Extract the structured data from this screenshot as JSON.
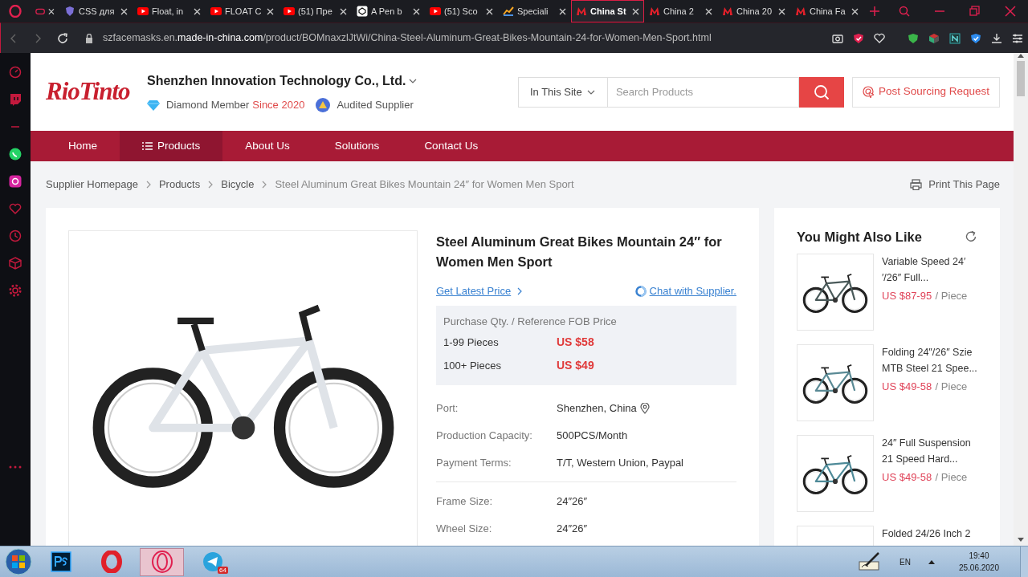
{
  "browser": {
    "tabs": [
      {
        "selected": false
      },
      {
        "title": "CSS для",
        "selected": false
      },
      {
        "title": "Float, in",
        "selected": false
      },
      {
        "title": "FLOAT C",
        "selected": false
      },
      {
        "title": "(51) Пре",
        "selected": false
      },
      {
        "title": "A Pen b",
        "selected": false
      },
      {
        "title": "(51) Sco",
        "selected": false
      },
      {
        "title": "Speciali",
        "selected": false
      },
      {
        "title": "China St",
        "selected": true
      },
      {
        "title": "China 2",
        "selected": false
      },
      {
        "title": "China 20",
        "selected": false
      },
      {
        "title": "China Fa",
        "selected": false
      }
    ],
    "url": "szfacemasks.en.**made-in-china.com**/product/BOMnaxzlJtWi/China-Steel-Aluminum-Great-Bikes-Mountain-24-for-Women-Men-Sport.html"
  },
  "header": {
    "logo": "RioTinto",
    "company": "Shenzhen Innovation Technology Co., Ltd.",
    "member": "Diamond Member",
    "since": "Since 2020",
    "audited": "Audited Supplier",
    "search_scope": "In This Site",
    "search_placeholder": "Search Products",
    "post_request": "Post Sourcing Request"
  },
  "nav": [
    {
      "label": "Home",
      "selected": false
    },
    {
      "label": "Products",
      "selected": true
    },
    {
      "label": "About Us",
      "selected": false
    },
    {
      "label": "Solutions",
      "selected": false
    },
    {
      "label": "Contact Us",
      "selected": false
    }
  ],
  "breadcrumb": [
    "Supplier Homepage",
    "Products",
    "Bicycle",
    "Steel Aluminum Great Bikes Mountain 24″ for Women Men Sport"
  ],
  "print": "Print This Page",
  "product": {
    "title": "Steel Aluminum Great Bikes Mountain 24″ for Women Men Sport",
    "get_price": "Get Latest Price",
    "chat": "Chat with Supplier.",
    "price_header": "Purchase Qty. / Reference FOB Price",
    "prices": [
      {
        "qty": "1-99 Pieces",
        "price": "US $58"
      },
      {
        "qty": "100+ Pieces",
        "price": "US $49"
      }
    ],
    "specs": [
      {
        "label": "Port:",
        "value": "Shenzhen, China",
        "pin": true
      },
      {
        "label": "Production Capacity:",
        "value": "500PCS/Month",
        "pin": false
      },
      {
        "label": "Payment Terms:",
        "value": "T/T, Western Union, Paypal",
        "pin": false
      }
    ],
    "attributes": [
      {
        "label": "Frame Size:",
        "value": "24″26″"
      },
      {
        "label": "Wheel Size:",
        "value": "24″26″"
      }
    ]
  },
  "related": {
    "title": "You Might Also Like",
    "items": [
      {
        "name": "Variable Speed 24′\n′/26″ Full...",
        "price": "US $87-95",
        "unit": "/ Piece"
      },
      {
        "name": "Folding 24″/26″ Szie\nMTB Steel 21 Spee...",
        "price": "US $49-58",
        "unit": "/ Piece"
      },
      {
        "name": "24″ Full Suspension\n21 Speed Hard...",
        "price": "US $49-58",
        "unit": "/ Piece"
      },
      {
        "name": "Folded 24/26 Inch 2"
      }
    ]
  },
  "taskbar": {
    "telegram_badge": "64",
    "lang": "EN",
    "time": "19:40",
    "date": "25.06.2020"
  }
}
